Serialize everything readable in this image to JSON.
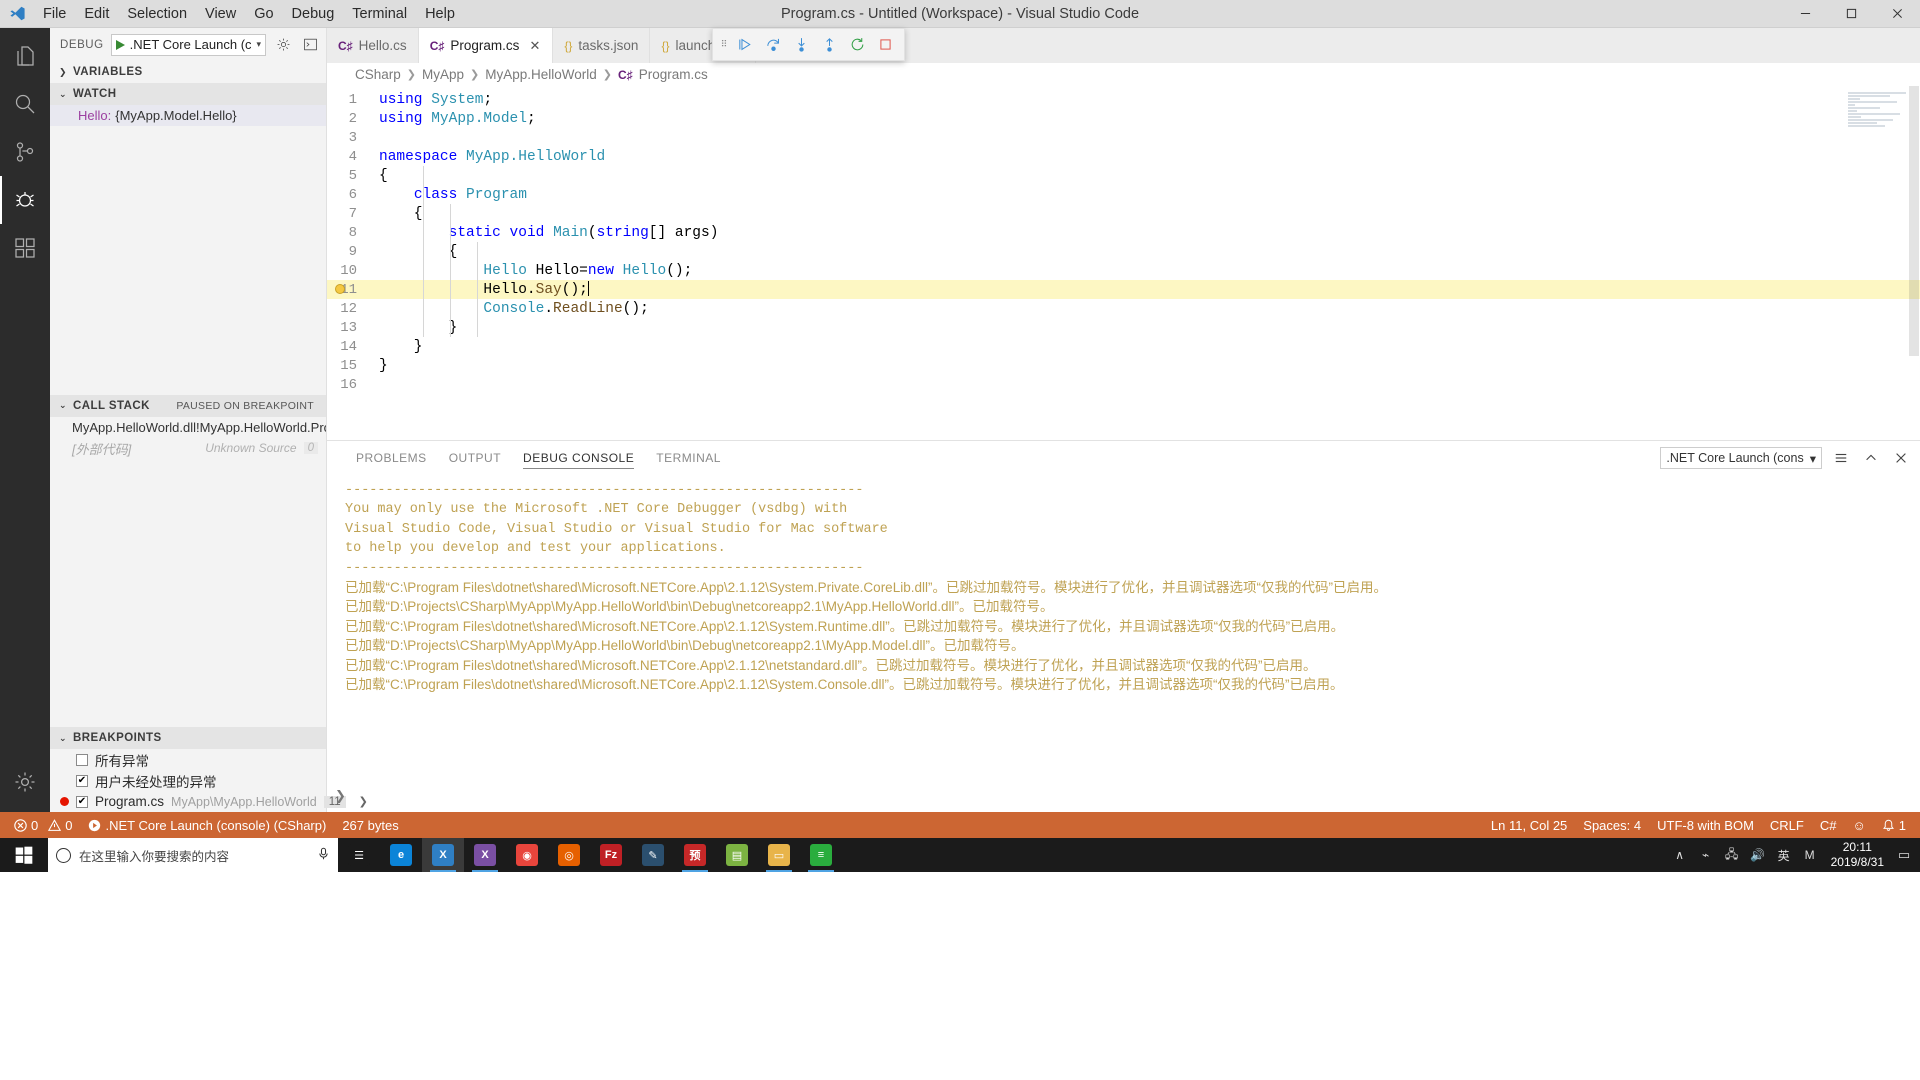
{
  "titlebar": {
    "window_title": "Program.cs - Untitled (Workspace) - Visual Studio Code",
    "menus": [
      "File",
      "Edit",
      "Selection",
      "View",
      "Go",
      "Debug",
      "Terminal",
      "Help"
    ],
    "controls": [
      "minimize-icon",
      "maximize-icon",
      "close-icon"
    ]
  },
  "activitybar": {
    "items": [
      {
        "name": "explorer",
        "icon": "files-icon",
        "active": false
      },
      {
        "name": "search",
        "icon": "search-icon",
        "active": false
      },
      {
        "name": "source-control",
        "icon": "source-control-icon",
        "active": false
      },
      {
        "name": "debug",
        "icon": "debug-icon",
        "active": true
      },
      {
        "name": "extensions",
        "icon": "extensions-icon",
        "active": false
      },
      {
        "name": "manage",
        "icon": "gear-icon",
        "active": false
      }
    ]
  },
  "sidebar": {
    "debug_label": "DEBUG",
    "config_name": ".NET Core Launch (console)",
    "config_caret": "▾",
    "gear_icon": "gear-icon",
    "console_icon": "open-console-icon",
    "sections": {
      "variables": {
        "title": "VARIABLES",
        "collapsed": true,
        "twisty": "❯"
      },
      "watch": {
        "title": "WATCH",
        "twisty": "⌄",
        "rows": [
          {
            "name": "Hello:",
            "value": "{MyApp.Model.Hello}"
          }
        ]
      },
      "callstack": {
        "title": "CALL STACK",
        "twisty": "⌄",
        "badge": "PAUSED ON BREAKPOINT",
        "rows": [
          {
            "label": "MyApp.HelloWorld.dll!MyApp.HelloWorld.Progr",
            "source": "",
            "num": "",
            "dim": false
          },
          {
            "label": "[外部代码]",
            "source": "Unknown Source",
            "num": "0",
            "dim": true
          }
        ]
      },
      "breakpoints": {
        "title": "BREAKPOINTS",
        "twisty": "⌄",
        "rows": [
          {
            "checked": false,
            "label": "所有异常",
            "sub": "",
            "line": "",
            "dot": false,
            "chev": ""
          },
          {
            "checked": true,
            "label": "用户未经处理的异常",
            "sub": "",
            "line": "",
            "dot": false,
            "chev": ""
          },
          {
            "checked": true,
            "label": "Program.cs",
            "sub": "MyApp\\MyApp.HelloWorld",
            "line": "11",
            "dot": true,
            "chev": "❯"
          }
        ]
      }
    }
  },
  "tabs": [
    {
      "label": "Hello.cs",
      "icon": "csharp-file-icon",
      "icon_glyph": "C♯",
      "kind": "cs",
      "active": false,
      "close": ""
    },
    {
      "label": "Program.cs",
      "icon": "csharp-file-icon",
      "icon_glyph": "C♯",
      "kind": "cs",
      "active": true,
      "close": "✕"
    },
    {
      "label": "tasks.json",
      "icon": "json-file-icon",
      "icon_glyph": "{}",
      "kind": "json",
      "active": false,
      "close": ""
    },
    {
      "label": "launch.json",
      "icon": "json-file-icon",
      "icon_glyph": "{}",
      "kind": "json",
      "active": false,
      "close": ""
    }
  ],
  "debug_toolbar": {
    "grip": "⠿",
    "buttons": [
      {
        "name": "continue-button",
        "icon": "play-icon",
        "color": "#3d8fd6"
      },
      {
        "name": "step-over-button",
        "icon": "step-over-icon",
        "color": "#3d8fd6"
      },
      {
        "name": "step-into-button",
        "icon": "step-into-icon",
        "color": "#3d8fd6"
      },
      {
        "name": "step-out-button",
        "icon": "step-out-icon",
        "color": "#3d8fd6"
      },
      {
        "name": "restart-button",
        "icon": "restart-icon",
        "color": "#2f9e44"
      },
      {
        "name": "stop-button",
        "icon": "stop-icon",
        "color": "#e05a4f"
      }
    ]
  },
  "breadcrumb": {
    "items": [
      "CSharp",
      "MyApp",
      "MyApp.HelloWorld",
      "Program.cs"
    ],
    "separator": "❯",
    "file_icon": "csharp-file-icon"
  },
  "editor": {
    "highlight_line": 11,
    "breakpoint_line": 11,
    "cursor": {
      "line": 11,
      "col": 25
    },
    "lines": [
      {
        "n": 1,
        "tokens": [
          {
            "t": "using",
            "c": "kw"
          },
          {
            "t": " ",
            "c": "plain"
          },
          {
            "t": "System",
            "c": "typ"
          },
          {
            "t": ";",
            "c": "plain"
          }
        ]
      },
      {
        "n": 2,
        "tokens": [
          {
            "t": "using",
            "c": "kw"
          },
          {
            "t": " ",
            "c": "plain"
          },
          {
            "t": "MyApp.Model",
            "c": "typ"
          },
          {
            "t": ";",
            "c": "plain"
          }
        ]
      },
      {
        "n": 3,
        "tokens": []
      },
      {
        "n": 4,
        "tokens": [
          {
            "t": "namespace",
            "c": "kw"
          },
          {
            "t": " ",
            "c": "plain"
          },
          {
            "t": "MyApp.HelloWorld",
            "c": "typ"
          }
        ]
      },
      {
        "n": 5,
        "tokens": [
          {
            "t": "{",
            "c": "plain"
          }
        ]
      },
      {
        "n": 6,
        "tokens": [
          {
            "t": "    ",
            "c": "plain"
          },
          {
            "t": "class",
            "c": "kw"
          },
          {
            "t": " ",
            "c": "plain"
          },
          {
            "t": "Program",
            "c": "typ"
          }
        ]
      },
      {
        "n": 7,
        "tokens": [
          {
            "t": "    {",
            "c": "plain"
          }
        ]
      },
      {
        "n": 8,
        "tokens": [
          {
            "t": "        ",
            "c": "plain"
          },
          {
            "t": "static",
            "c": "kw"
          },
          {
            "t": " ",
            "c": "plain"
          },
          {
            "t": "void",
            "c": "kw"
          },
          {
            "t": " ",
            "c": "plain"
          },
          {
            "t": "Main",
            "c": "typ"
          },
          {
            "t": "(",
            "c": "plain"
          },
          {
            "t": "string",
            "c": "kw"
          },
          {
            "t": "[] args)",
            "c": "plain"
          }
        ]
      },
      {
        "n": 9,
        "tokens": [
          {
            "t": "        {",
            "c": "plain"
          }
        ]
      },
      {
        "n": 10,
        "tokens": [
          {
            "t": "            ",
            "c": "plain"
          },
          {
            "t": "Hello",
            "c": "typ"
          },
          {
            "t": " Hello=",
            "c": "plain"
          },
          {
            "t": "new",
            "c": "kw"
          },
          {
            "t": " ",
            "c": "plain"
          },
          {
            "t": "Hello",
            "c": "typ"
          },
          {
            "t": "();",
            "c": "plain"
          }
        ]
      },
      {
        "n": 11,
        "tokens": [
          {
            "t": "            Hello.",
            "c": "plain"
          },
          {
            "t": "Say",
            "c": "mth"
          },
          {
            "t": "();",
            "c": "plain"
          }
        ]
      },
      {
        "n": 12,
        "tokens": [
          {
            "t": "            ",
            "c": "plain"
          },
          {
            "t": "Console",
            "c": "typ"
          },
          {
            "t": ".",
            "c": "plain"
          },
          {
            "t": "ReadLine",
            "c": "mth"
          },
          {
            "t": "();",
            "c": "plain"
          }
        ]
      },
      {
        "n": 13,
        "tokens": [
          {
            "t": "        }",
            "c": "plain"
          }
        ]
      },
      {
        "n": 14,
        "tokens": [
          {
            "t": "    }",
            "c": "plain"
          }
        ]
      },
      {
        "n": 15,
        "tokens": [
          {
            "t": "}",
            "c": "plain"
          }
        ]
      },
      {
        "n": 16,
        "tokens": []
      }
    ]
  },
  "panel": {
    "tabs": [
      {
        "label": "PROBLEMS",
        "active": false
      },
      {
        "label": "OUTPUT",
        "active": false
      },
      {
        "label": "DEBUG CONSOLE",
        "active": true
      },
      {
        "label": "TERMINAL",
        "active": false
      }
    ],
    "select_value": ".NET Core Launch (cons",
    "select_caret": "▾",
    "actions": [
      {
        "name": "clear-console-button",
        "icon": "list-icon"
      },
      {
        "name": "maximize-panel-button",
        "icon": "chevron-up-icon"
      },
      {
        "name": "close-panel-button",
        "icon": "close-icon"
      }
    ],
    "prompt": "❯",
    "console_lines": [
      {
        "text": "----------------------------------------------------------------",
        "zh": false
      },
      {
        "text": "You may only use the Microsoft .NET Core Debugger (vsdbg) with",
        "zh": false
      },
      {
        "text": "Visual Studio Code, Visual Studio or Visual Studio for Mac software",
        "zh": false
      },
      {
        "text": "to help you develop and test your applications.",
        "zh": false
      },
      {
        "text": "----------------------------------------------------------------",
        "zh": false
      },
      {
        "text": "已加载“C:\\Program Files\\dotnet\\shared\\Microsoft.NETCore.App\\2.1.12\\System.Private.CoreLib.dll”。已跳过加载符号。模块进行了优化，并且调试器选项“仅我的代码”已启用。",
        "zh": true
      },
      {
        "text": "已加载“D:\\Projects\\CSharp\\MyApp\\MyApp.HelloWorld\\bin\\Debug\\netcoreapp2.1\\MyApp.HelloWorld.dll”。已加载符号。",
        "zh": true
      },
      {
        "text": "已加载“C:\\Program Files\\dotnet\\shared\\Microsoft.NETCore.App\\2.1.12\\System.Runtime.dll”。已跳过加载符号。模块进行了优化，并且调试器选项“仅我的代码”已启用。",
        "zh": true
      },
      {
        "text": "已加载“D:\\Projects\\CSharp\\MyApp\\MyApp.HelloWorld\\bin\\Debug\\netcoreapp2.1\\MyApp.Model.dll”。已加载符号。",
        "zh": true
      },
      {
        "text": "已加载“C:\\Program Files\\dotnet\\shared\\Microsoft.NETCore.App\\2.1.12\\netstandard.dll”。已跳过加载符号。模块进行了优化，并且调试器选项“仅我的代码”已启用。",
        "zh": true
      },
      {
        "text": "已加载“C:\\Program Files\\dotnet\\shared\\Microsoft.NETCore.App\\2.1.12\\System.Console.dll”。已跳过加载符号。模块进行了优化，并且调试器选项“仅我的代码”已启用。",
        "zh": true
      }
    ]
  },
  "statusbar": {
    "background": "#cc6633",
    "left": [
      {
        "name": "errors-warnings",
        "icon": "error-icon",
        "text": "0"
      },
      {
        "name": "warnings",
        "icon": "warning-icon",
        "text": "0"
      },
      {
        "name": "debug-session",
        "icon": "play-icon",
        "text": ".NET Core Launch (console) (CSharp)"
      },
      {
        "name": "memory-usage",
        "icon": "",
        "text": "267 bytes"
      }
    ],
    "right": [
      {
        "name": "cursor-position",
        "text": "Ln 11, Col 25"
      },
      {
        "name": "indentation",
        "text": "Spaces: 4"
      },
      {
        "name": "encoding",
        "text": "UTF-8 with BOM"
      },
      {
        "name": "line-endings",
        "text": "CRLF"
      },
      {
        "name": "language-mode",
        "text": "C#"
      },
      {
        "name": "feedback-smiley",
        "text": "☺"
      },
      {
        "name": "notifications",
        "text": "1"
      }
    ]
  },
  "taskbar": {
    "search_placeholder": "在这里输入你要搜索的内容",
    "start_icon": "windows-logo-icon",
    "search_icon": "search-circle-icon",
    "mic_icon": "microphone-icon",
    "items": [
      {
        "name": "task-view",
        "glyph": "☰",
        "color": "#1b1b1b",
        "running": false,
        "active": false
      },
      {
        "name": "edge",
        "glyph": "e",
        "color": "#0b84d8",
        "running": false,
        "active": false
      },
      {
        "name": "vscode",
        "glyph": "X",
        "color": "#2f7fc4",
        "running": true,
        "active": true
      },
      {
        "name": "vscode-insiders",
        "glyph": "X",
        "color": "#7a4fa3",
        "running": true,
        "active": false
      },
      {
        "name": "chrome",
        "glyph": "◉",
        "color": "#e8453c",
        "running": false,
        "active": false
      },
      {
        "name": "firefox",
        "glyph": "◎",
        "color": "#e66000",
        "running": false,
        "active": false
      },
      {
        "name": "filezilla",
        "glyph": "Fz",
        "color": "#bf2025",
        "running": false,
        "active": false
      },
      {
        "name": "editor-app",
        "glyph": "✎",
        "color": "#2b4f6e",
        "running": false,
        "active": false
      },
      {
        "name": "red-app",
        "glyph": "预",
        "color": "#c62828",
        "running": true,
        "active": false
      },
      {
        "name": "notes-app",
        "glyph": "▤",
        "color": "#7cb342",
        "running": false,
        "active": false
      },
      {
        "name": "file-explorer",
        "glyph": "▭",
        "color": "#e8b44a",
        "running": true,
        "active": false
      },
      {
        "name": "wechat",
        "glyph": "≡",
        "color": "#2aad3e",
        "running": true,
        "active": false
      }
    ],
    "tray": [
      "∧",
      "⌁",
      "🖧",
      "🔊",
      "英",
      "M"
    ],
    "clock_time": "20:11",
    "clock_date": "2019/8/31",
    "notification_glyph": "▭"
  }
}
